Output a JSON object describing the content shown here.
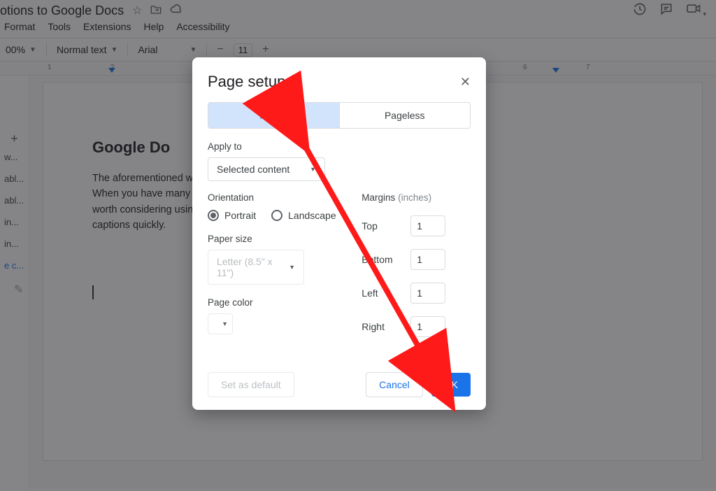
{
  "titlebar": {
    "title": "otions to Google Docs"
  },
  "menubar": {
    "items": [
      "Format",
      "Tools",
      "Extensions",
      "Help",
      "Accessibility"
    ]
  },
  "toolbar": {
    "zoom": "00%",
    "style": "Normal text",
    "font": "Arial",
    "fontsize": "11"
  },
  "ruler": {
    "ticks": [
      "1",
      "2",
      "6",
      "7"
    ]
  },
  "outline": {
    "items": [
      "w...",
      "abl...",
      "abl...",
      "in...",
      "in...",
      "e c..."
    ],
    "active_index": 5
  },
  "doc": {
    "heading": "Google Do",
    "body_lines": [
      "The aforementioned ways allow you to add captions as you'd like.",
      "When you have many images, it can be time and stressful. It's",
      "worth considering using an add-on that will help you add your",
      "captions quickly."
    ]
  },
  "dialog": {
    "title": "Page setup",
    "tabs": {
      "pages": "Pages",
      "pageless": "Pageless"
    },
    "apply_to_label": "Apply to",
    "apply_to_value": "Selected content",
    "orientation_label": "Orientation",
    "orientation_portrait": "Portrait",
    "orientation_landscape": "Landscape",
    "paper_size_label": "Paper size",
    "paper_size_value": "Letter (8.5\" x 11\")",
    "page_color_label": "Page color",
    "margins_label": "Margins",
    "margins_unit": "(inches)",
    "margins": {
      "top_label": "Top",
      "top": "1",
      "bottom_label": "Bottom",
      "bottom": "1",
      "left_label": "Left",
      "left": "1",
      "right_label": "Right",
      "right": "1"
    },
    "set_default": "Set as default",
    "cancel": "Cancel",
    "ok": "OK"
  }
}
